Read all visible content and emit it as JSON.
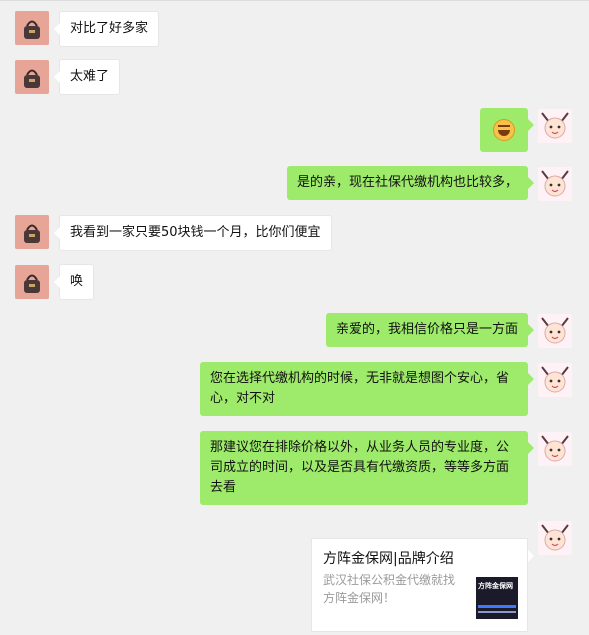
{
  "messages": [
    {
      "from": "customer",
      "text": "对比了好多家"
    },
    {
      "from": "customer",
      "text": "太难了"
    },
    {
      "from": "agent",
      "emoji": "laughing-tears-emoji"
    },
    {
      "from": "agent",
      "text": "是的亲，现在社保代缴机构也比较多，"
    },
    {
      "from": "customer",
      "text": "我看到一家只要50块钱一个月，比你们便宜"
    },
    {
      "from": "customer",
      "text": "唤"
    },
    {
      "from": "agent",
      "text": "亲爱的，我相信价格只是一方面"
    },
    {
      "from": "agent",
      "text": "您在选择代缴机构的时候，无非就是想图个安心，省心，对不对"
    },
    {
      "from": "agent",
      "text": "那建议您在排除价格以外，从业务人员的专业度，公司成立的时间，以及是否具有代缴资质，等等多方面去看"
    }
  ],
  "link_card": {
    "title": "方阵金保网|品牌介绍",
    "description": "武汉社保公积金代缴就找方阵金保网！",
    "thumb_text": "方阵金保网"
  },
  "colors": {
    "background": "#f0f0f0",
    "incoming_bubble": "#ffffff",
    "outgoing_bubble": "#9eea6a"
  },
  "icons": {
    "customer_avatar": "handbag-avatar-icon",
    "agent_avatar": "cartoon-avatar-icon"
  }
}
